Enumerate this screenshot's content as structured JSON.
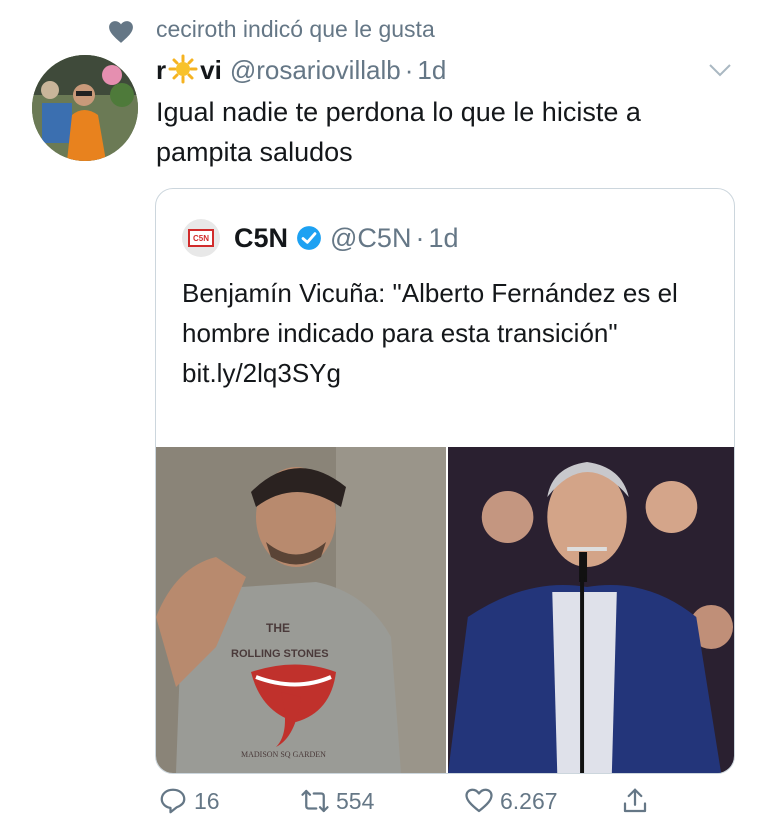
{
  "social_context": {
    "text": "ceciroth indicó que le gusta"
  },
  "tweet": {
    "display_name": "r☀️vi",
    "display_name_prefix": "r",
    "display_name_suffix": "vi",
    "handle": "@rosariovillalb",
    "separator": "·",
    "time": "1d",
    "text": "Igual nadie te perdona lo que le hiciste a pampita saludos"
  },
  "quote": {
    "avatar_text": "C5N",
    "name": "C5N",
    "handle": "@C5N",
    "separator": "·",
    "time": "1d",
    "text": "Benjamín Vicuña: \"Alberto Fernández es el hombre indicado para esta transición\"",
    "link": "bit.ly/2lq3SYg",
    "shirt_text_top": "THE",
    "shirt_text_band": "ROLLING STONES",
    "shirt_text_bottom": "MADISON SQ GARDEN"
  },
  "actions": {
    "reply_count": "16",
    "retweet_count": "554",
    "like_count": "6.267"
  },
  "colors": {
    "accent": "#1da1f2",
    "muted": "#657786"
  }
}
